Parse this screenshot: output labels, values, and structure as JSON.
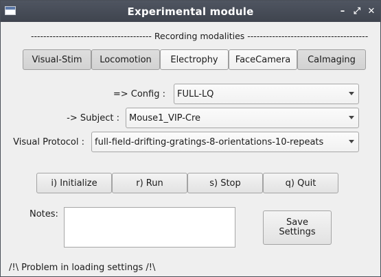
{
  "window": {
    "title": "Experimental module"
  },
  "separator_text": "--------------------------------------- Recording modalities ---------------------------------------",
  "tabs": [
    "Visual-Stim",
    "Locomotion",
    "Electrophy",
    "FaceCamera",
    "CaImaging"
  ],
  "active_tabs": [
    "Electrophy",
    "FaceCamera"
  ],
  "config": {
    "label": "=> Config :",
    "value": "FULL-LQ"
  },
  "subject": {
    "label": "-> Subject :",
    "value": "Mouse1_VIP-Cre"
  },
  "protocol": {
    "label": "Visual Protocol :",
    "value": "full-field-drifting-gratings-8-orientations-10-repeats"
  },
  "buttons": {
    "initialize": "i) Initialize",
    "run": "r) Run",
    "stop": "s) Stop",
    "quit": "q) Quit"
  },
  "notes": {
    "label": "Notes:",
    "value": ""
  },
  "save_button": {
    "line1": "Save",
    "line2": "Settings"
  },
  "status": "/!\\ Problem in loading settings /!\\"
}
